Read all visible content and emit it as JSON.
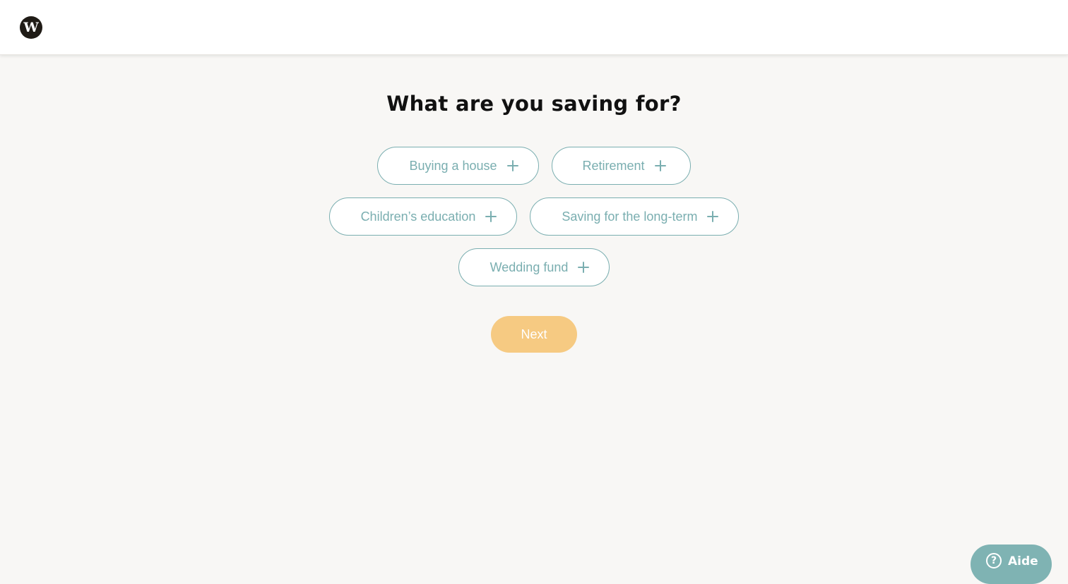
{
  "header": {
    "logo_letter": "W"
  },
  "page": {
    "title": "What are you saving for?"
  },
  "goals": [
    {
      "label": "Buying a house"
    },
    {
      "label": "Retirement"
    },
    {
      "label": "Children’s education"
    },
    {
      "label": "Saving for the long-term"
    },
    {
      "label": "Wedding fund"
    }
  ],
  "actions": {
    "next_label": "Next"
  },
  "help": {
    "icon_glyph": "?",
    "label": "Aide"
  },
  "colors": {
    "accent_teal": "#7aaeb0",
    "next_button": "#f6ca82",
    "help_button": "#7fb3b3",
    "background": "#f8f7f5"
  },
  "icons": {
    "goal_add": "plus-icon",
    "help": "question-circle-icon"
  }
}
